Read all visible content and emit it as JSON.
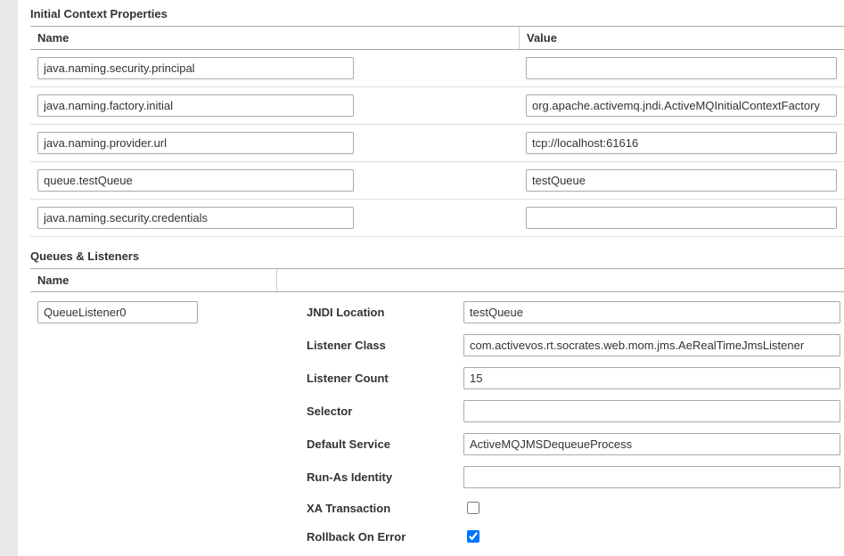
{
  "initContext": {
    "title": "Initial Context Properties",
    "headers": {
      "name": "Name",
      "value": "Value"
    },
    "rows": [
      {
        "name": "java.naming.security.principal",
        "value": ""
      },
      {
        "name": "java.naming.factory.initial",
        "value": "org.apache.activemq.jndi.ActiveMQInitialContextFactory"
      },
      {
        "name": "java.naming.provider.url",
        "value": "tcp://localhost:61616"
      },
      {
        "name": "queue.testQueue",
        "value": "testQueue"
      },
      {
        "name": "java.naming.security.credentials",
        "value": ""
      }
    ]
  },
  "queues": {
    "title": "Queues & Listeners",
    "header_name": "Name",
    "listener_name": "QueueListener0",
    "fields": {
      "jndi_location": {
        "label": "JNDI Location",
        "value": "testQueue"
      },
      "listener_class": {
        "label": "Listener Class",
        "value": "com.activevos.rt.socrates.web.mom.jms.AeRealTimeJmsListener"
      },
      "listener_count": {
        "label": "Listener Count",
        "value": "15"
      },
      "selector": {
        "label": "Selector",
        "value": ""
      },
      "default_service": {
        "label": "Default Service",
        "value": "ActiveMQJMSDequeueProcess"
      },
      "run_as_identity": {
        "label": "Run-As Identity",
        "value": ""
      },
      "xa_transaction": {
        "label": "XA Transaction",
        "checked": false
      },
      "rollback_on_error": {
        "label": "Rollback On Error",
        "checked": true
      }
    }
  }
}
